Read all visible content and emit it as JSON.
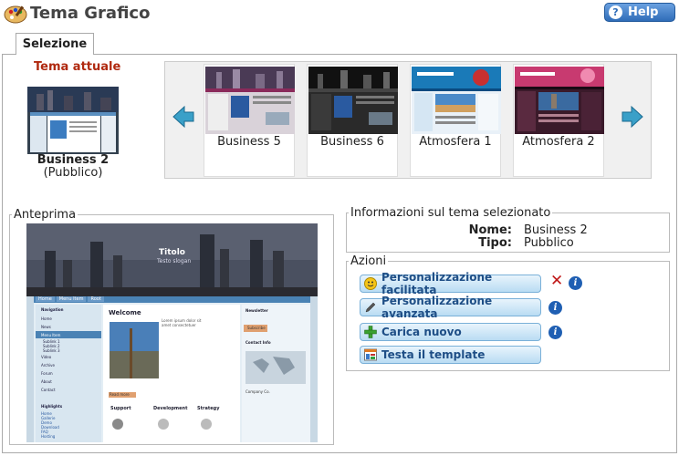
{
  "header": {
    "title": "Tema Grafico",
    "help_label": "Help"
  },
  "tabs": [
    {
      "label": "Selezione",
      "active": true
    }
  ],
  "current_theme": {
    "heading": "Tema attuale",
    "name": "Business 2",
    "type": "(Pubblico)"
  },
  "gallery": {
    "items": [
      {
        "name": "Business 5"
      },
      {
        "name": "Business 6"
      },
      {
        "name": "Atmosfera 1"
      },
      {
        "name": "Atmosfera 2"
      }
    ]
  },
  "preview": {
    "legend": "Anteprima",
    "site_title": "Titolo",
    "site_slogan": "Testo slogan",
    "nav_tabs": [
      "Home",
      "Menu Item",
      "Root"
    ],
    "sidebar_heading": "Navigation",
    "sidebar_items": [
      "Home",
      "News",
      "Menu Item",
      "Sublink 1",
      "Sublink 2",
      "Sublink 3",
      "Video",
      "Archive",
      "Forum",
      "About",
      "Contact"
    ],
    "sidebar_heading2": "Highlights",
    "sidebar_links": [
      "Home",
      "Gallerie",
      "Demo",
      "Download",
      "FAQ",
      "Hosting"
    ],
    "welcome": "Welcome",
    "read_more": "Read more",
    "col_titles": [
      "Support",
      "Development",
      "Strategy"
    ],
    "right_newsletter": "Newsletter",
    "subscribe": "Subscribe",
    "contact_info": "Contact Info",
    "company": "Company Co.",
    "lorem": "Lorem ipsum dolor sit amet consectetuer"
  },
  "info": {
    "legend": "Informazioni sul tema selezionato",
    "name_label": "Nome:",
    "name_value": "Business 2",
    "type_label": "Tipo:",
    "type_value": "Pubblico"
  },
  "actions": {
    "legend": "Azioni",
    "buttons": [
      {
        "label": "Personalizzazione facilitata",
        "icon": "smiley-icon"
      },
      {
        "label": "Personalizzazione avanzata",
        "icon": "pencil-icon"
      },
      {
        "label": "Carica nuovo",
        "icon": "plus-icon"
      },
      {
        "label": "Testa il template",
        "icon": "template-icon"
      }
    ]
  },
  "colors": {
    "accent": "#2f6db8",
    "current_heading": "#b02a10",
    "button_text": "#1e4e86"
  }
}
